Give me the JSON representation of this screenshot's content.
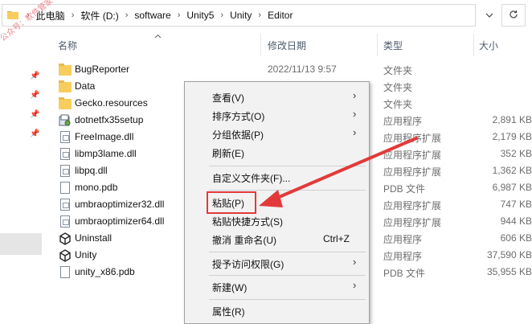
{
  "address_bar": {
    "breadcrumbs": [
      "此电脑",
      "软件 (D:)",
      "software",
      "Unity5",
      "Unity",
      "Editor"
    ]
  },
  "columns": {
    "name": "名称",
    "date": "修改日期",
    "type": "类型",
    "size": "大小"
  },
  "files": [
    {
      "name": "BugReporter",
      "date": "2022/11/13 9:57",
      "type": "文件夹",
      "size": "",
      "icon": "folder-icon"
    },
    {
      "name": "Data",
      "date": "",
      "type": "文件夹",
      "size": "",
      "icon": "folder-icon"
    },
    {
      "name": "Gecko.resources",
      "date": "",
      "type": "文件夹",
      "size": "",
      "icon": "folder-icon"
    },
    {
      "name": "dotnetfx35setup",
      "date": "",
      "type": "应用程序",
      "size": "2,891 KB",
      "icon": "setup-exe-icon"
    },
    {
      "name": "FreeImage.dll",
      "date": "",
      "type": "应用程序扩展",
      "size": "2,179 KB",
      "icon": "dll-icon"
    },
    {
      "name": "libmp3lame.dll",
      "date": "",
      "type": "应用程序扩展",
      "size": "352 KB",
      "icon": "dll-icon"
    },
    {
      "name": "libpq.dll",
      "date": "",
      "type": "应用程序扩展",
      "size": "1,362 KB",
      "icon": "dll-icon"
    },
    {
      "name": "mono.pdb",
      "date": "",
      "type": "PDB 文件",
      "size": "6,987 KB",
      "icon": "file-icon"
    },
    {
      "name": "umbraoptimizer32.dll",
      "date": "",
      "type": "应用程序扩展",
      "size": "747 KB",
      "icon": "dll-icon"
    },
    {
      "name": "umbraoptimizer64.dll",
      "date": "",
      "type": "应用程序扩展",
      "size": "944 KB",
      "icon": "dll-icon"
    },
    {
      "name": "Uninstall",
      "date": "",
      "type": "应用程序",
      "size": "606 KB",
      "icon": "unity-icon"
    },
    {
      "name": "Unity",
      "date": "",
      "type": "应用程序",
      "size": "37,590 KB",
      "icon": "unity-icon"
    },
    {
      "name": "unity_x86.pdb",
      "date": "",
      "type": "PDB 文件",
      "size": "35,955 KB",
      "icon": "file-icon"
    }
  ],
  "context_menu": {
    "items": [
      {
        "label": "查看(V)",
        "submenu": true
      },
      {
        "label": "排序方式(O)",
        "submenu": true
      },
      {
        "label": "分组依据(P)",
        "submenu": true
      },
      {
        "label": "刷新(E)",
        "submenu": false
      },
      {
        "label": "自定义文件夹(F)...",
        "submenu": false
      },
      {
        "label": "粘贴(P)",
        "submenu": false
      },
      {
        "label": "粘贴快捷方式(S)",
        "submenu": false
      },
      {
        "label": "撤消 重命名(U)",
        "submenu": false,
        "accelerator": "Ctrl+Z"
      },
      {
        "label": "授予访问权限(G)",
        "submenu": true
      },
      {
        "label": "新建(W)",
        "submenu": true
      },
      {
        "label": "属性(R)",
        "submenu": false
      }
    ]
  },
  "watermark": "公众号：软件管家",
  "colors": {
    "highlight_box": "#e23a3a",
    "arrow": "#e23a3a",
    "folder": "#f7cd5e",
    "menu_bg": "#f2f2f2"
  }
}
